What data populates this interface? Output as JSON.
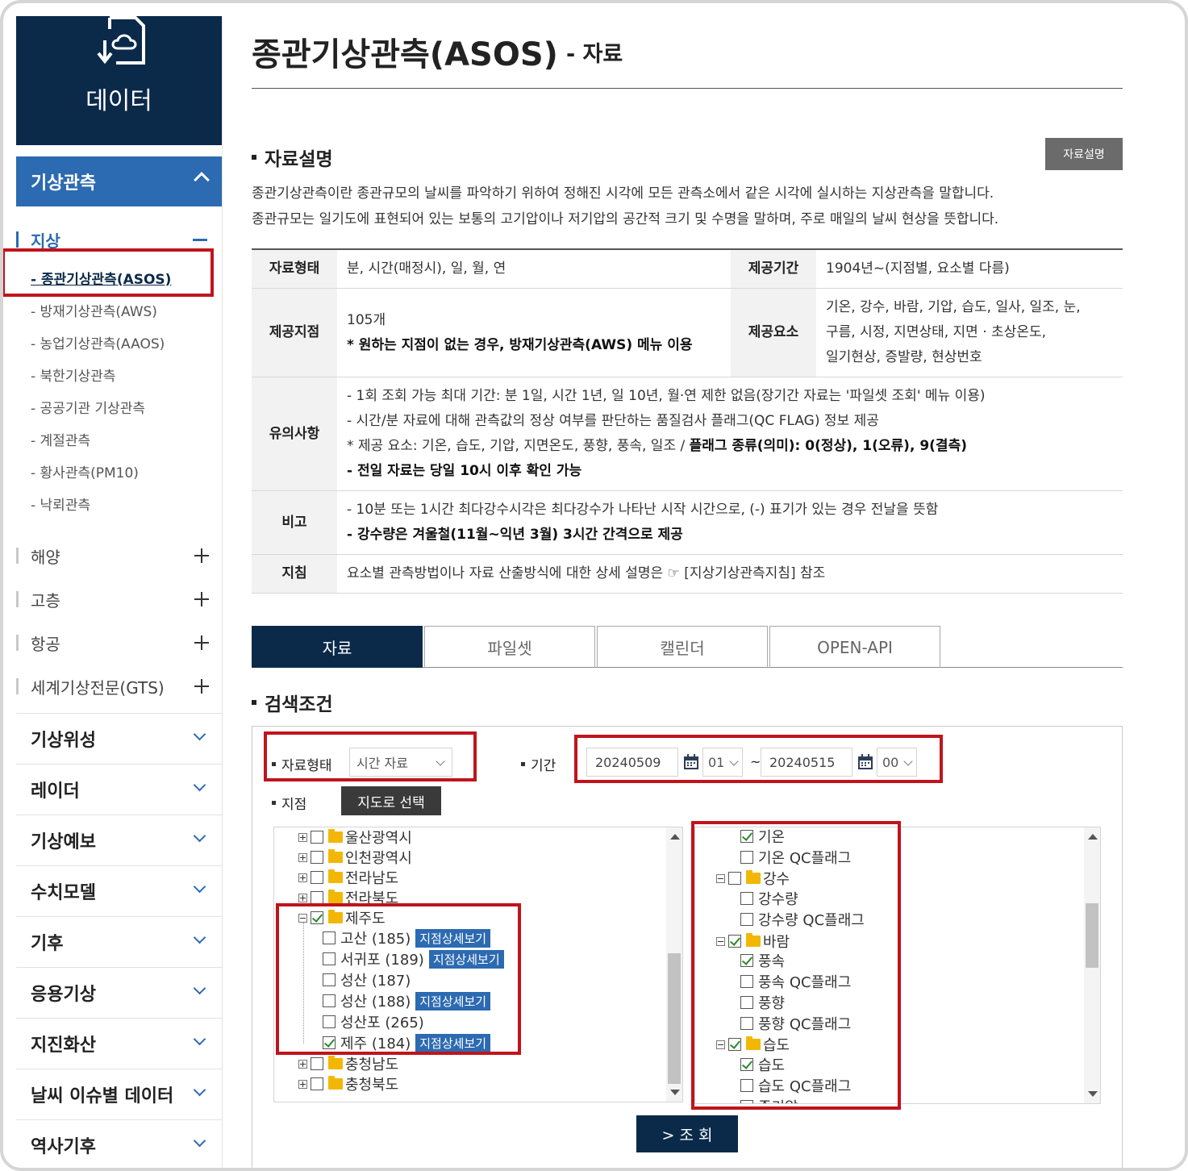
{
  "sidebar": {
    "header_title": "데이터",
    "main_category": "기상관측",
    "active_sub": "지상",
    "items": [
      "- 종관기상관측(ASOS)",
      "- 방재기상관측(AWS)",
      "- 농업기상관측(AAOS)",
      "- 북한기상관측",
      "- 공공기관 기상관측",
      "- 계절관측",
      "- 황사관측(PM10)",
      "- 낙뢰관측"
    ],
    "closed_subs": [
      "해양",
      "고층",
      "항공",
      "세계기상전문(GTS)"
    ],
    "categories": [
      "기상위성",
      "레이더",
      "기상예보",
      "수치모델",
      "기후",
      "응용기상",
      "지진화산",
      "날씨 이슈별 데이터",
      "역사기후"
    ]
  },
  "page": {
    "title": "종관기상관측(ASOS)",
    "subtitle": "- 자료"
  },
  "description": {
    "heading": "자료설명",
    "button": "자료설명",
    "line1": "종관기상관측이란 종관규모의 날씨를 파악하기 위하여 정해진 시각에 모든 관측소에서 같은 시각에 실시하는 지상관측을 말합니다.",
    "line2": "종관규모는 일기도에 표현되어 있는 보통의 고기압이나 저기압의 공간적 크기 및 수명을 말하며, 주로 매일의 날씨 현상을 뜻합니다."
  },
  "info": {
    "format_label": "자료형태",
    "format_value": "분, 시간(매정시), 일, 월, 연",
    "period_label": "제공기간",
    "period_value": "1904년~(지점별, 요소별 다름)",
    "station_label": "제공지점",
    "station_count": "105개",
    "station_note": "* 원하는 지점이 없는 경우, 방재기상관측(AWS) 메뉴 이용",
    "element_label": "제공요소",
    "element_line1": "기온, 강수, 바람, 기압, 습도, 일사, 일조, 눈,",
    "element_line2": "구름, 시정, 지면상태, 지면 · 초상온도,",
    "element_line3": "일기현상, 증발량, 현상번호",
    "notes_label": "유의사항",
    "notes_1": "- 1회 조회 가능 최대 기간: 분 1일, 시간 1년, 일 10년, 월·연 제한 없음(장기간 자료는 '파일셋 조회' 메뉴 이용)",
    "notes_2": "- 시간/분 자료에 대해 관측값의 정상 여부를 판단하는 품질검사 플래그(QC FLAG) 정보 제공",
    "notes_3a": "* 제공 요소: 기온, 습도, 기압, 지면온도, 풍향, 풍속, 일조 / ",
    "notes_3b": "플래그 종류(의미): 0(정상), 1(오류), 9(결측)",
    "notes_4": "- 전일 자료는 당일 10시 이후 확인 가능",
    "remark_label": "비고",
    "remark_1": "- 10분 또는 1시간 최다강수시각은 최다강수가 나타난 시작 시간으로, (-) 표기가 있는 경우 전날을 뜻함",
    "remark_2": "- 강수량은 겨울철(11월~익년 3월) 3시간 간격으로 제공",
    "guide_label": "지침",
    "guide_value": "요소별 관측방법이나 자료 산출방식에 대한 상세 설명은 ☞ [지상기상관측지침] 참조"
  },
  "tabs": [
    "자료",
    "파일셋",
    "캘린더",
    "OPEN-API"
  ],
  "search": {
    "heading": "검색조건",
    "format_label": "자료형태",
    "format_value": "시간 자료",
    "period_label": "기간",
    "start_date": "20240509",
    "start_hour": "01",
    "tilde": "~",
    "end_date": "20240515",
    "end_hour": "00",
    "station_label": "지점",
    "map_button": "지도로 선택",
    "query_button": "> 조 회",
    "detail_badge": "지점상세보기",
    "regions": [
      {
        "label": "울산광역시"
      },
      {
        "label": "인천광역시"
      },
      {
        "label": "전라남도"
      },
      {
        "label": "전라북도"
      },
      {
        "label": "제주도"
      },
      {
        "label": "충청남도"
      },
      {
        "label": "충청북도"
      }
    ],
    "stations": [
      {
        "label": "고산 (185)",
        "checked": false,
        "detail": true
      },
      {
        "label": "서귀포 (189)",
        "checked": false,
        "detail": true
      },
      {
        "label": "성산 (187)",
        "checked": false,
        "detail": false
      },
      {
        "label": "성산 (188)",
        "checked": false,
        "detail": true
      },
      {
        "label": "성산포 (265)",
        "checked": false,
        "detail": false
      },
      {
        "label": "제주 (184)",
        "checked": true,
        "detail": true
      }
    ],
    "elements": {
      "temp": "기온",
      "temp_qc": "기온 QC플래그",
      "rain_group": "강수",
      "rain": "강수량",
      "rain_qc": "강수량 QC플래그",
      "wind_group": "바람",
      "wind_speed": "풍속",
      "wind_speed_qc": "풍속 QC플래그",
      "wind_dir": "풍향",
      "wind_dir_qc": "풍향 QC플래그",
      "hum_group": "습도",
      "hum": "습도",
      "hum_qc": "습도 QC플래그",
      "partial": "증기압"
    }
  }
}
